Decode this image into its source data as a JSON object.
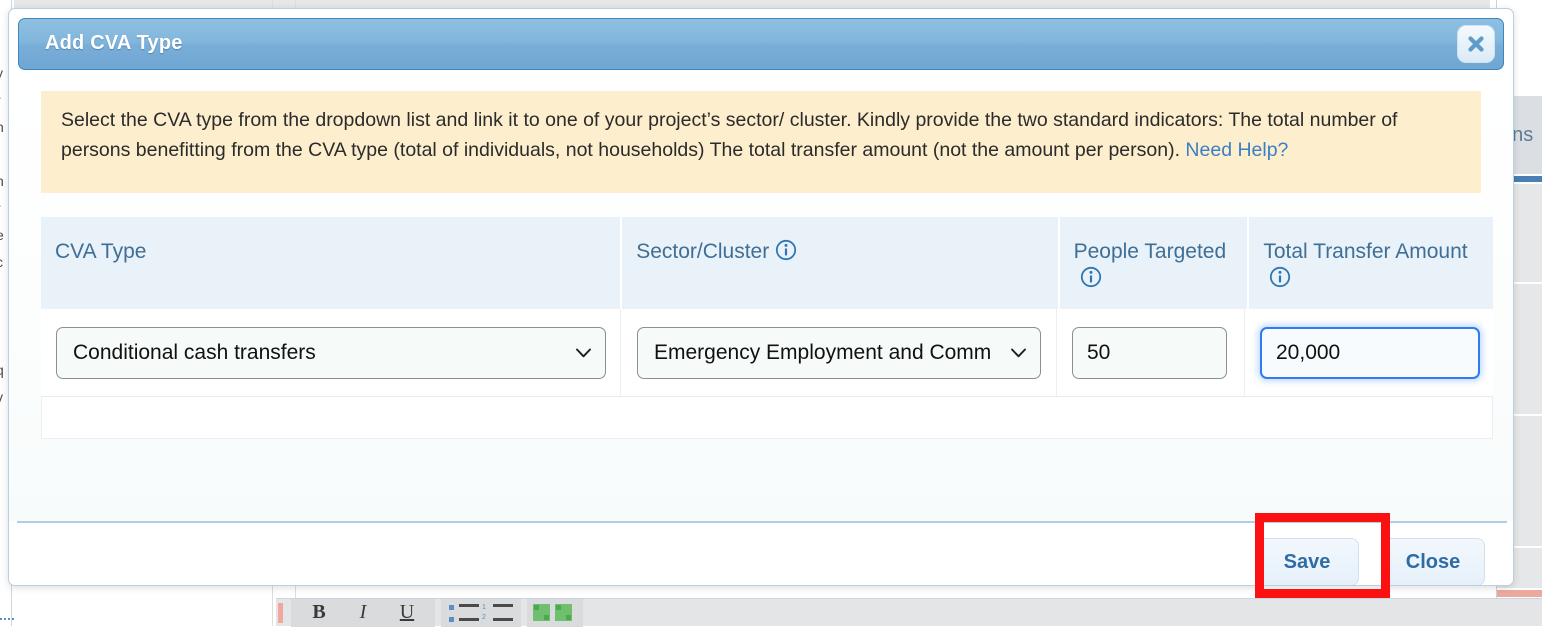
{
  "modal": {
    "title": "Add CVA Type",
    "close_icon": "close-x-icon",
    "banner": {
      "text": "Select the CVA type from the dropdown list and link it to one of your project’s sector/ cluster. Kindly provide the two standard indicators: The total number of persons benefitting from the CVA type (total of individuals, not households) The total transfer amount (not the amount per person).",
      "link_label": "Need Help?",
      "background_color": "#fdeecd",
      "link_color": "#3b7fc4"
    },
    "table": {
      "headers": [
        {
          "label": "CVA Type",
          "info_icon": false
        },
        {
          "label": "Sector/Cluster",
          "info_icon": true
        },
        {
          "label": "People Targeted",
          "info_icon": true
        },
        {
          "label": "Total Transfer Amount",
          "info_icon": true
        }
      ],
      "row": {
        "cva_type": "Conditional cash transfers",
        "sector_cluster": "Emergency Employment and Comm",
        "people_targeted": "50",
        "total_transfer_amount": "20,000"
      },
      "header_background": "#e9f1f9",
      "header_text_color": "#3f6f96"
    },
    "footer": {
      "save_label": "Save",
      "close_label": "Close"
    },
    "titlebar_color": "#79aed8",
    "focus_color": "#2e7df0"
  },
  "annotation": {
    "color": "#fb1111",
    "target": "save-button"
  },
  "background": {
    "right_panel_text": "ans",
    "editor_toolbar": {
      "bold_label": "B",
      "italic_label": "I",
      "underline_label": "U",
      "bullet_list_icon": "bullet-list-icon",
      "numbered_list_icon": "numbered-list-icon",
      "number_markers": [
        "1",
        "2"
      ]
    },
    "left_edge_glyphs": "y\nr\nn\nl\nn\nr\ne\nc\n.\n:\nq\nv\n|\ni"
  }
}
